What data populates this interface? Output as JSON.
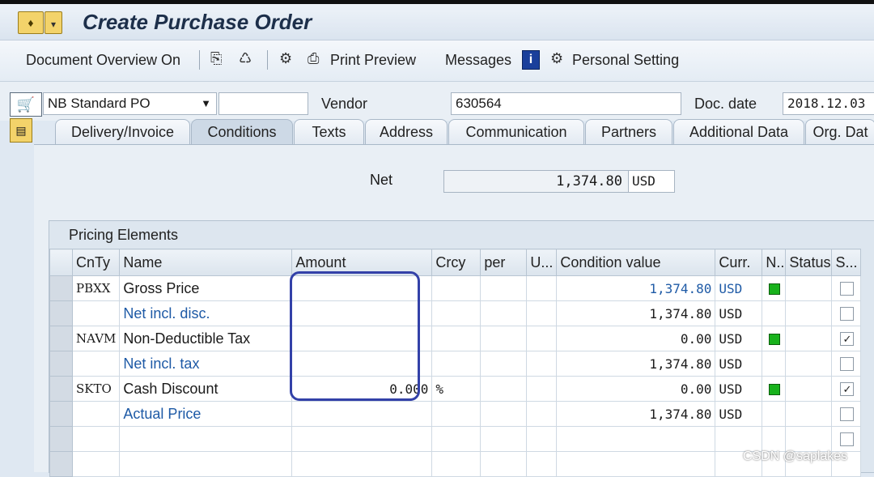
{
  "window": {
    "title": "Create Purchase Order"
  },
  "toolbar": {
    "doc_overview": "Document Overview On",
    "print_preview": "Print Preview",
    "messages": "Messages",
    "personal_setting": "Personal Setting"
  },
  "header": {
    "po_type": "NB Standard PO",
    "vendor_label": "Vendor",
    "vendor_value": "630564",
    "doc_date_label": "Doc. date",
    "doc_date_value": "2018.12.03"
  },
  "tabs": [
    {
      "label": "Delivery/Invoice"
    },
    {
      "label": "Conditions"
    },
    {
      "label": "Texts"
    },
    {
      "label": "Address"
    },
    {
      "label": "Communication"
    },
    {
      "label": "Partners"
    },
    {
      "label": "Additional Data"
    },
    {
      "label": "Org. Dat"
    }
  ],
  "net": {
    "label": "Net",
    "value": "1,374.80",
    "currency": "USD"
  },
  "pricing": {
    "title": "Pricing Elements",
    "columns": [
      "CnTy",
      "Name",
      "Amount",
      "Crcy",
      "per",
      "U...",
      "Condition value",
      "Curr.",
      "N..",
      "Status",
      "S..."
    ],
    "rows": [
      {
        "cnty": "PBXX",
        "name": "Gross Price",
        "amount": "",
        "crcy": "",
        "value": "1,374.80",
        "curr": "USD",
        "status": true,
        "checked": false,
        "name_link": false,
        "value_link": true
      },
      {
        "cnty": "",
        "name": "Net incl. disc.",
        "amount": "",
        "crcy": "",
        "value": "1,374.80",
        "curr": "USD",
        "status": false,
        "checked": false,
        "name_link": true,
        "value_link": false
      },
      {
        "cnty": "NAVM",
        "name": "Non-Deductible Tax",
        "amount": "",
        "crcy": "",
        "value": "0.00",
        "curr": "USD",
        "status": true,
        "checked": true,
        "name_link": false,
        "value_link": false
      },
      {
        "cnty": "",
        "name": "Net incl. tax",
        "amount": "",
        "crcy": "",
        "value": "1,374.80",
        "curr": "USD",
        "status": false,
        "checked": false,
        "name_link": true,
        "value_link": false
      },
      {
        "cnty": "SKTO",
        "name": "Cash Discount",
        "amount": "0.000",
        "crcy": "%",
        "value": "0.00",
        "curr": "USD",
        "status": true,
        "checked": true,
        "name_link": false,
        "value_link": false
      },
      {
        "cnty": "",
        "name": "Actual Price",
        "amount": "",
        "crcy": "",
        "value": "1,374.80",
        "curr": "USD",
        "status": false,
        "checked": false,
        "name_link": true,
        "value_link": false
      },
      {
        "cnty": "",
        "name": "",
        "amount": "",
        "crcy": "",
        "value": "",
        "curr": "",
        "status": false,
        "checked": false,
        "name_link": false,
        "value_link": false
      },
      {
        "cnty": "",
        "name": "",
        "amount": "",
        "crcy": "",
        "value": "",
        "curr": "",
        "status": false,
        "checked": false,
        "name_link": false,
        "value_link": false
      }
    ]
  },
  "watermark": "CSDN @saplakes",
  "colors": {
    "accent": "#3341a8",
    "link": "#1e5aa6",
    "status_green": "#18b21c"
  }
}
